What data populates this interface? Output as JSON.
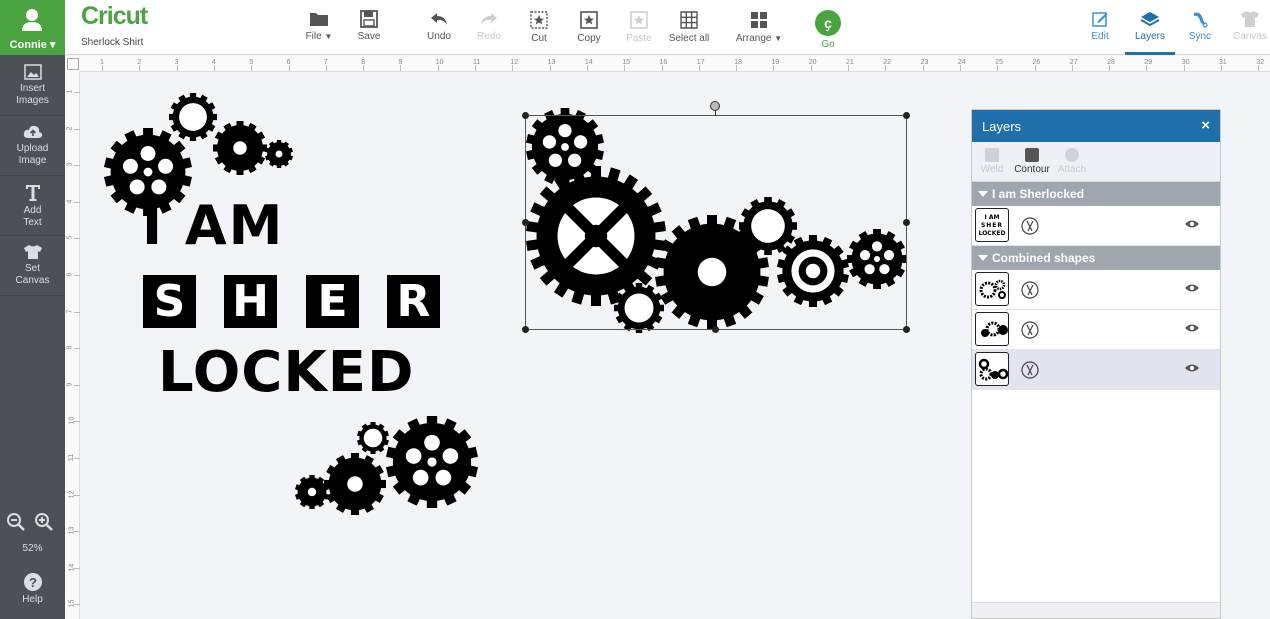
{
  "sidebar": {
    "user_name": "Connie",
    "items": [
      {
        "label1": "Insert",
        "label2": "Images"
      },
      {
        "label1": "Upload",
        "label2": "Image"
      },
      {
        "label1": "Add",
        "label2": "Text"
      },
      {
        "label1": "Set",
        "label2": "Canvas"
      }
    ],
    "zoom_level": "52%",
    "help_label": "Help"
  },
  "toolbar": {
    "logo": "Cricut",
    "project_name": "Sherlock Shirt",
    "file": "File",
    "save": "Save",
    "undo": "Undo",
    "redo": "Redo",
    "cut": "Cut",
    "copy": "Copy",
    "paste": "Paste",
    "select_all": "Select all",
    "arrange": "Arrange",
    "go": "Go",
    "edit": "Edit",
    "layers": "Layers",
    "sync": "Sync",
    "canvas": "Canvas"
  },
  "design": {
    "line1": "I AM",
    "letters": [
      "S",
      "H",
      "E",
      "R"
    ],
    "line3": "LOCKED"
  },
  "layers_panel": {
    "title": "Layers",
    "actions": {
      "weld": "Weld",
      "contour": "Contour",
      "attach": "Attach"
    },
    "groups": [
      {
        "name": "I am Sherlocked",
        "rows": 1
      },
      {
        "name": "Combined shapes",
        "rows": 3
      }
    ],
    "thumb_text": [
      "I AM",
      "SHER",
      "LOCKED"
    ]
  },
  "colors": {
    "brand_green": "#4aa541",
    "layers_blue": "#1f6fab",
    "sidebar_bg": "#4d5156"
  }
}
